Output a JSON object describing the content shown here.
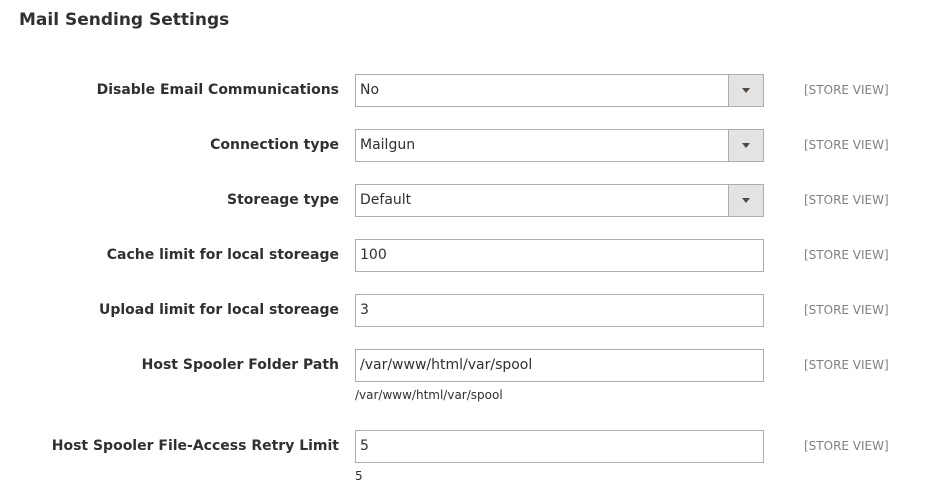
{
  "section": {
    "title": "Mail Sending Settings"
  },
  "fields": [
    {
      "label": "Disable Email Communications",
      "value": "No",
      "type": "select",
      "scope": "[STORE VIEW]"
    },
    {
      "label": "Connection type",
      "value": "Mailgun",
      "type": "select",
      "scope": "[STORE VIEW]"
    },
    {
      "label": "Storeage type",
      "value": "Default",
      "type": "select",
      "scope": "[STORE VIEW]"
    },
    {
      "label": "Cache limit for local storeage",
      "value": "100",
      "type": "text",
      "scope": "[STORE VIEW]"
    },
    {
      "label": "Upload limit for local storeage",
      "value": "3",
      "type": "text",
      "scope": "[STORE VIEW]"
    },
    {
      "label": "Host Spooler Folder Path",
      "value": "/var/www/html/var/spool",
      "type": "text",
      "scope": "[STORE VIEW]",
      "note": "/var/www/html/var/spool"
    },
    {
      "label": "Host Spooler File-Access Retry Limit",
      "value": "5",
      "type": "text",
      "scope": "[STORE VIEW]",
      "note": "5"
    }
  ]
}
